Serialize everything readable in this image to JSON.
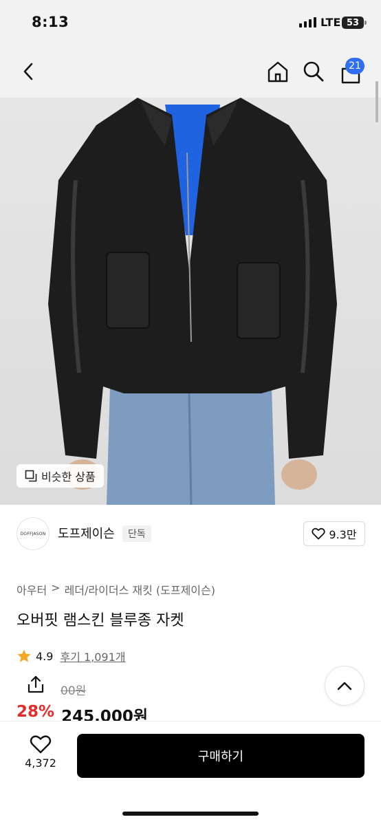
{
  "status_bar": {
    "time": "8:13",
    "network": "LTE",
    "battery": "53"
  },
  "header": {
    "cart_count": "21",
    "icons": [
      "back-icon",
      "home-icon",
      "search-icon",
      "cart-icon"
    ]
  },
  "product_image": {
    "similar_button_label": "비슷한 상품"
  },
  "brand": {
    "logo_text": "DOFFJASON",
    "name": "도프제이슨",
    "badge": "단독",
    "likes": "9.3만"
  },
  "breadcrumb": {
    "category": "아우터",
    "separator": ">",
    "subcategory": "레더/라이더스 재킷 (도프제이슨)"
  },
  "product": {
    "title": "오버핏 램스킨 블루종 자켓",
    "rating": "4.9",
    "reviews": "후기 1,091개",
    "original_price": "00원",
    "discount": "28%",
    "price": "245,000원"
  },
  "bottom_bar": {
    "wish_count": "4,372",
    "buy_label": "구매하기"
  },
  "colors": {
    "accent": "#2f6ff0",
    "discount": "#e62b2b",
    "star": "#f6a623",
    "buy_button": "#000000"
  }
}
